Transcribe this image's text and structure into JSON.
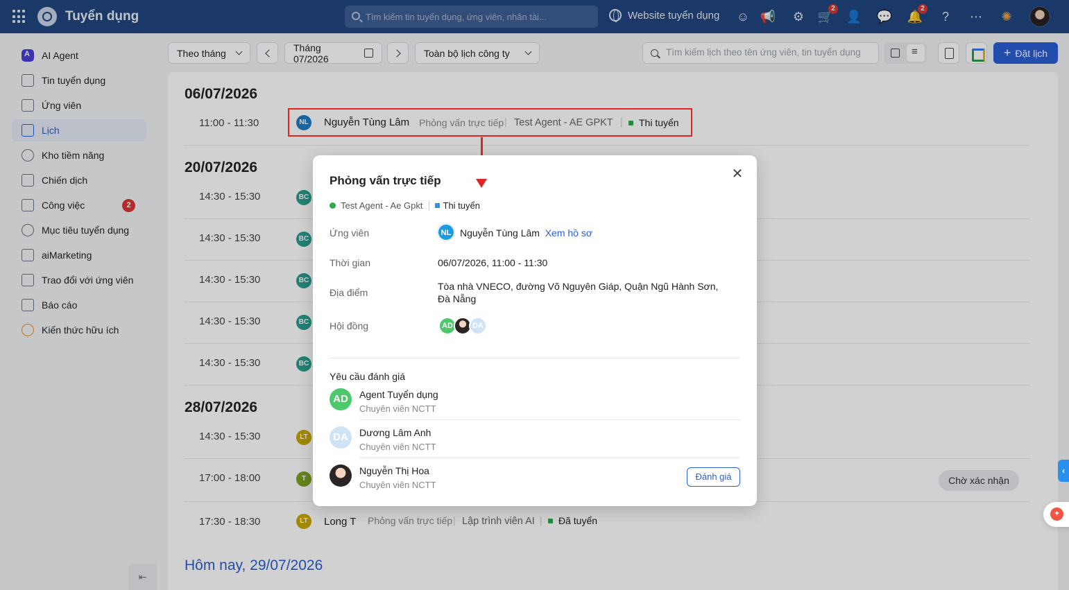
{
  "header": {
    "app_title": "Tuyển dụng",
    "search_placeholder": "Tìm kiếm tin tuyển dụng, ứng viên, nhân tài...",
    "website_link": "Website tuyển dụng",
    "cart_badge": "2",
    "notif_badge": "2",
    "icons": [
      "grid-icon",
      "bot-icon",
      "megaphone-icon",
      "gear-icon",
      "cart-icon",
      "add-user-icon",
      "chat-icon",
      "bell-icon",
      "help-icon",
      "more-icon",
      "idea-icon"
    ]
  },
  "sidebar": {
    "items": [
      {
        "label": "AI Agent",
        "icon": "ai-agent-icon"
      },
      {
        "label": "Tin tuyển dụng",
        "icon": "job-post-icon"
      },
      {
        "label": "Ứng viên",
        "icon": "candidate-icon"
      },
      {
        "label": "Lịch",
        "icon": "calendar-icon",
        "active": true
      },
      {
        "label": "Kho tiềm năng",
        "icon": "talent-pool-icon"
      },
      {
        "label": "Chiến dịch",
        "icon": "campaign-icon"
      },
      {
        "label": "Công việc",
        "icon": "task-icon",
        "badge": "2"
      },
      {
        "label": "Mục tiêu tuyển dụng",
        "icon": "target-icon"
      },
      {
        "label": "aiMarketing",
        "icon": "marketing-icon"
      },
      {
        "label": "Trao đổi với ứng viên",
        "icon": "message-icon"
      },
      {
        "label": "Báo cáo",
        "icon": "report-icon"
      },
      {
        "label": "Kiến thức hữu ích",
        "icon": "knowledge-icon"
      }
    ]
  },
  "toolbar": {
    "view_select": "Theo tháng",
    "month_label": "Tháng 07/2026",
    "scope_select": "Toàn bộ lịch công ty",
    "search_placeholder": "Tìm kiếm lịch theo tên ứng viên, tin tuyển dụng",
    "book_button": "Đặt lịch"
  },
  "schedule": {
    "groups": [
      {
        "date": "06/07/2026"
      },
      {
        "date": "20/07/2026"
      },
      {
        "date": "28/07/2026"
      }
    ],
    "today_label": "Hôm nay, 29/07/2026",
    "rows": [
      {
        "time": "11:00 - 11:30",
        "initials": "NL",
        "name": "Nguyễn Tùng Lâm",
        "type": "Phỏng vấn trực tiếp",
        "job": "Test Agent - AE GPKT",
        "status": "Thi tuyển",
        "color": "#1e7bc4"
      },
      {
        "time": "14:30 - 15:30",
        "initials": "BC",
        "color": "#2a9d8f"
      },
      {
        "time": "14:30 - 15:30",
        "initials": "BC",
        "color": "#2a9d8f"
      },
      {
        "time": "14:30 - 15:30",
        "initials": "BC",
        "color": "#2a9d8f"
      },
      {
        "time": "14:30 - 15:30",
        "initials": "BC",
        "color": "#2a9d8f"
      },
      {
        "time": "14:30 - 15:30",
        "initials": "BC",
        "color": "#2a9d8f"
      },
      {
        "time": "14:30 - 15:30",
        "initials": "LT",
        "color": "#c9a800"
      },
      {
        "time": "17:00 - 18:00",
        "initials": "T",
        "color": "#7aa320",
        "pending": "Chờ xác nhận"
      },
      {
        "time": "17:30 - 18:30",
        "initials": "LT",
        "name": "Long T",
        "type": "Phỏng vấn trực tiếp",
        "job": "Lập trình viên AI",
        "status": "Đã tuyển",
        "color": "#c9a800"
      }
    ]
  },
  "modal": {
    "title": "Phỏng vấn trực tiếp",
    "job_tag": "Test Agent - Ae Gpkt",
    "stage_tag": "Thi tuyển",
    "candidate_label": "Ứng viên",
    "candidate_initials": "NL",
    "candidate_name": "Nguyễn Tùng Lâm",
    "view_profile": "Xem hồ sơ",
    "time_label": "Thời gian",
    "time_value": "06/07/2026, 11:00 - 11:30",
    "location_label": "Địa điểm",
    "location_value": "Tòa nhà VNECO, đường Võ Nguyên Giáp, Quận Ngũ Hành Sơn, Đà Nẵng",
    "council_label": "Hội đồng",
    "council": [
      {
        "initials": "AD",
        "color": "#4cc96a"
      },
      {
        "initials": "",
        "color": "#2b2424"
      },
      {
        "initials": "DA",
        "color": "#cfe3f5"
      }
    ],
    "eval_title": "Yêu cầu đánh giá",
    "reviewers": [
      {
        "initials": "AD",
        "name": "Agent Tuyển dụng",
        "role": "Chuyên viên NCTT",
        "color": "#4cc96a"
      },
      {
        "initials": "DA",
        "name": "Dương Lâm Anh",
        "role": "Chuyên viên NCTT",
        "color": "#cfe3f5"
      },
      {
        "initials": "",
        "name": "Nguyễn Thị Hoa",
        "role": "Chuyên viên NCTT",
        "color": "#2b2424"
      }
    ],
    "rate_button": "Đánh giá"
  }
}
